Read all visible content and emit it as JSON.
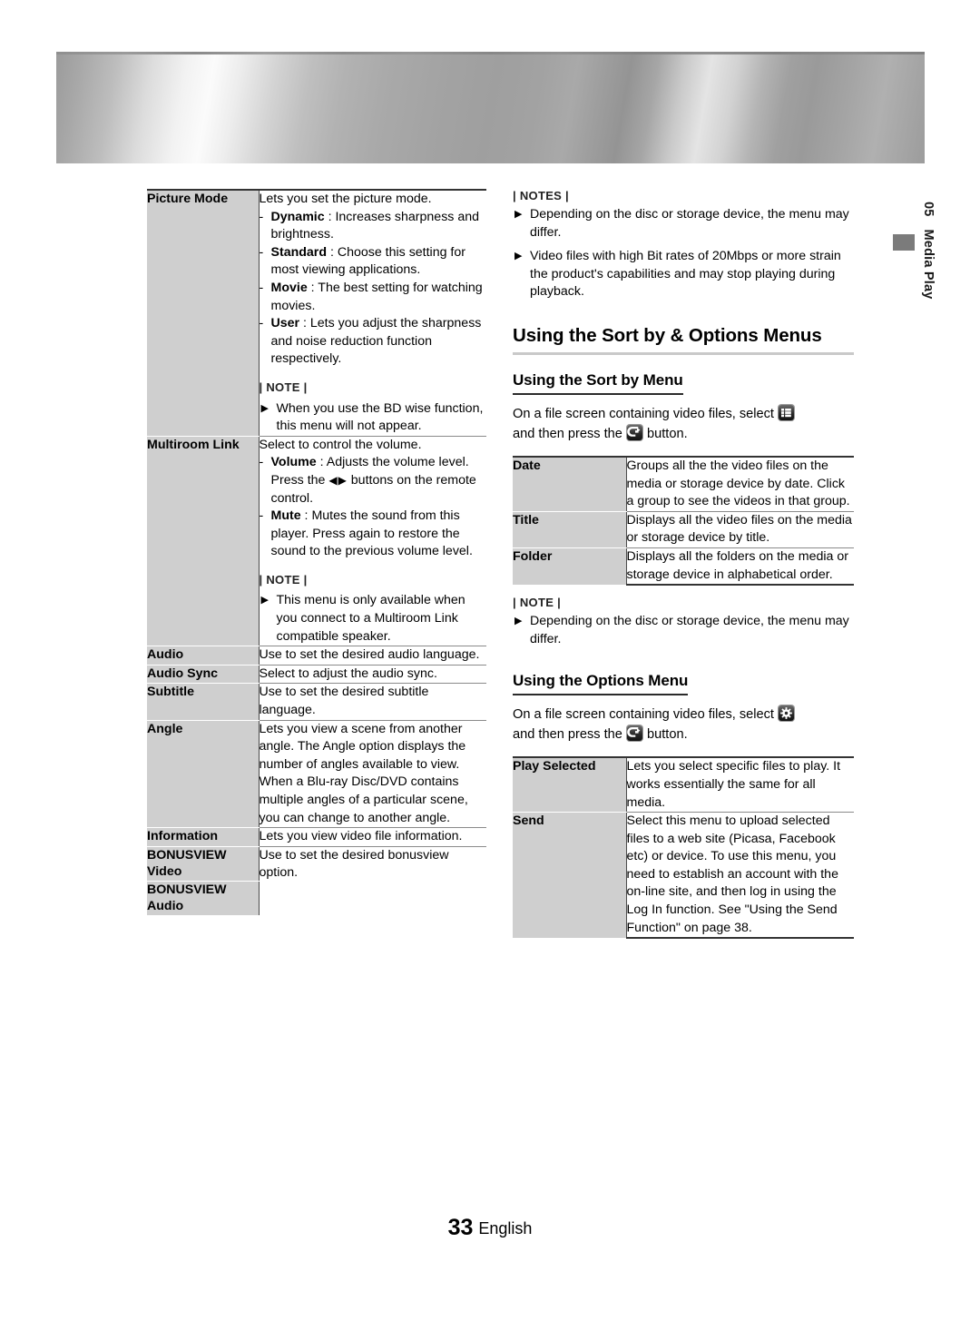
{
  "chapter_tab": {
    "number": "05",
    "title": "Media Play"
  },
  "footer": {
    "page_number": "33",
    "language": "English"
  },
  "left_table": {
    "rows": [
      {
        "label": "Picture Mode",
        "intro": "Lets you set the picture mode.",
        "items": [
          {
            "term": "Dynamic",
            "sep": " : ",
            "text": "Increases sharpness and brightness."
          },
          {
            "term": "Standard",
            "sep": " : ",
            "text": "Choose this setting for most viewing applications."
          },
          {
            "term": "Movie",
            "sep": " : ",
            "text": "The best setting for watching movies."
          },
          {
            "term": "User",
            "sep": " : ",
            "text": "Lets you adjust the sharpness and noise reduction function respectively."
          }
        ],
        "note_head": "| NOTE |",
        "notes": [
          "When you use the BD wise function, this menu will not appear."
        ]
      },
      {
        "label": "Multiroom Link",
        "intro": "Select to control the volume.",
        "items": [
          {
            "term": "Volume",
            "sep": " : ",
            "text": "Adjusts the volume level. Press the ",
            "arrows": "◀▶",
            "text_after": " buttons on the remote control."
          },
          {
            "term": "Mute",
            "sep": " : ",
            "text": "Mutes the sound from this player. Press again to restore the sound to the previous volume level."
          }
        ],
        "note_head": "| NOTE |",
        "notes": [
          "This menu is only available when you connect to a Multiroom Link compatible speaker."
        ]
      },
      {
        "label": "Audio",
        "intro": "Use to set the desired audio language."
      },
      {
        "label": "Audio Sync",
        "intro": "Select to adjust the audio sync."
      },
      {
        "label": "Subtitle",
        "intro": "Use to set the desired subtitle language."
      },
      {
        "label": "Angle",
        "intro": "Lets you view a scene from another angle. The Angle option displays the number of angles available to view. When a Blu-ray Disc/DVD contains multiple angles of a particular scene, you can change to another angle."
      },
      {
        "label": "Information",
        "intro": "Lets you view video file information."
      },
      {
        "label": "BONUSVIEW Video",
        "intro": "Use to set the desired bonusview option."
      },
      {
        "label": "BONUSVIEW Audio",
        "intro": ""
      }
    ]
  },
  "right_col": {
    "top_note_head": "| NOTES |",
    "top_notes": [
      "Depending on the disc or storage device, the menu may differ.",
      "Video files with high Bit rates of 20Mbps or more strain the product's capabilities and may stop playing during playback."
    ],
    "section_title": "Using the Sort by & Options Menus",
    "sortby": {
      "heading": "Using the Sort by Menu",
      "lead_1": "On a file screen containing video files, select",
      "lead_2": "and then press the",
      "lead_3": "button.",
      "list_icon": "sort-list-icon",
      "enter_icon": "enter-button-icon",
      "rows": [
        {
          "label": "Date",
          "desc": "Groups all the the video files on the media or storage device by date. Click a group to see the videos in that group."
        },
        {
          "label": "Title",
          "desc": "Displays all the video files on the media or storage device by title."
        },
        {
          "label": "Folder",
          "desc": "Displays all the folders on the media or storage device in alphabetical order."
        }
      ],
      "note_head": "| NOTE |",
      "notes": [
        "Depending on the disc or storage device, the menu may differ."
      ]
    },
    "options": {
      "heading": "Using the Options Menu",
      "lead_1": "On a file screen containing video files, select",
      "lead_2": "and then press the",
      "lead_3": "button.",
      "gear_icon": "options-gear-icon",
      "enter_icon": "enter-button-icon",
      "rows": [
        {
          "label": "Play Selected",
          "desc": "Lets you select specific files to play. It works essentially the same for all media."
        },
        {
          "label": "Send",
          "desc": "Select this menu to upload selected files to a web site (Picasa, Facebook etc) or device. To use this menu, you need to establish an account with the on-line site, and then log in using the Log In function. See \"Using the Send Function\" on page 38."
        }
      ]
    }
  }
}
